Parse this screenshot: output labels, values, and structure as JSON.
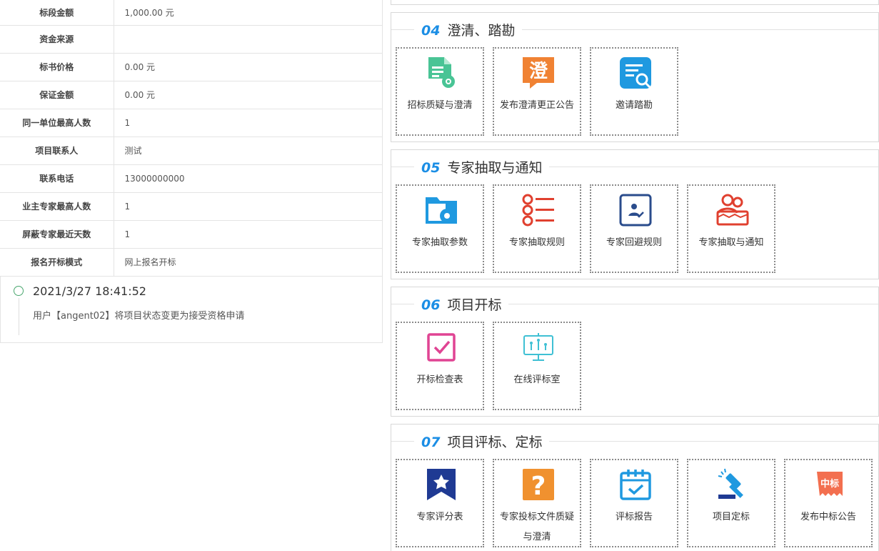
{
  "info_table": [
    {
      "label": "标段金额",
      "value": "1,000.00 元"
    },
    {
      "label": "资金来源",
      "value": ""
    },
    {
      "label": "标书价格",
      "value": "0.00 元"
    },
    {
      "label": "保证金额",
      "value": "0.00 元"
    },
    {
      "label": "同一单位最高人数",
      "value": "1"
    },
    {
      "label": "项目联系人",
      "value": "测试"
    },
    {
      "label": "联系电话",
      "value": "13000000000"
    },
    {
      "label": "业主专家最高人数",
      "value": "1"
    },
    {
      "label": "屏蔽专家最近天数",
      "value": "1"
    },
    {
      "label": "报名开标模式",
      "value": "网上报名开标"
    }
  ],
  "timeline": {
    "time": "2021/3/27 18:41:52",
    "text": "用户【angent02】将项目状态变更为接受资格申请"
  },
  "sections": [
    {
      "num": "04",
      "title": "澄清、踏勘",
      "cards": [
        {
          "label": "招标质疑与澄清",
          "icon": "doc-gear-icon"
        },
        {
          "label": "发布澄清更正公告",
          "icon": "clarify-bubble-icon"
        },
        {
          "label": "邀请踏勘",
          "icon": "doc-search-icon"
        }
      ]
    },
    {
      "num": "05",
      "title": "专家抽取与通知",
      "cards": [
        {
          "label": "专家抽取参数",
          "icon": "folder-gear-icon"
        },
        {
          "label": "专家抽取规则",
          "icon": "list-icon"
        },
        {
          "label": "专家回避规则",
          "icon": "user-check-icon"
        },
        {
          "label": "专家抽取与通知",
          "icon": "people-group-icon"
        }
      ]
    },
    {
      "num": "06",
      "title": "项目开标",
      "cards": [
        {
          "label": "开标检查表",
          "icon": "checkbox-icon"
        },
        {
          "label": "在线评标室",
          "icon": "presentation-board-icon"
        }
      ]
    },
    {
      "num": "07",
      "title": "项目评标、定标",
      "cards": [
        {
          "label": "专家评分表",
          "icon": "star-bookmark-icon"
        },
        {
          "label": "专家投标文件质疑与澄清",
          "icon": "question-icon"
        },
        {
          "label": "评标报告",
          "icon": "calendar-check-icon"
        },
        {
          "label": "项目定标",
          "icon": "gavel-icon"
        },
        {
          "label": "发布中标公告",
          "icon": "winning-notice-icon"
        }
      ]
    }
  ],
  "badge_text": "中标",
  "colors": {
    "accent_blue": "#1b8ee5",
    "green": "#49c495",
    "orange": "#f08233",
    "red": "#e0402f",
    "navy": "#1f3a93",
    "pink": "#e04493",
    "teal": "#3fc0d4",
    "sky": "#1f99e0"
  }
}
